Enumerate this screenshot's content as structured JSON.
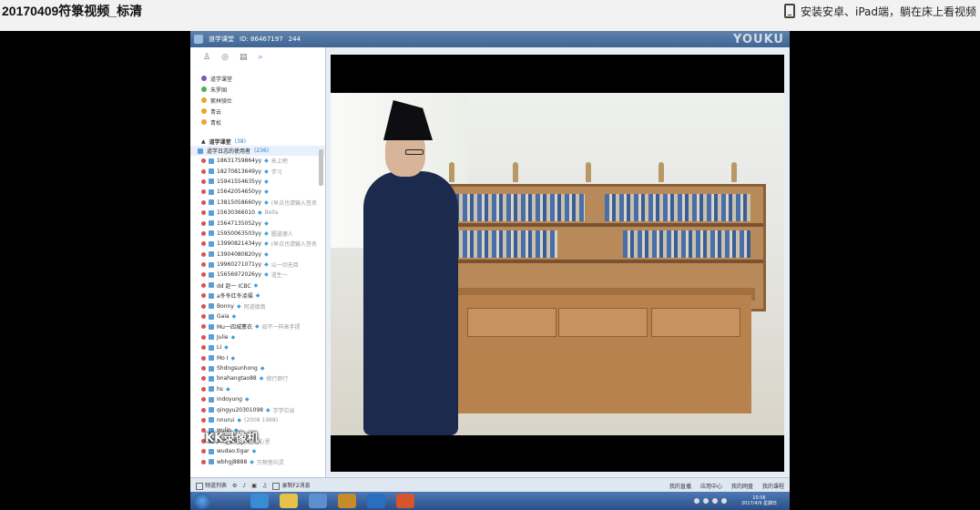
{
  "page": {
    "title": "20170409符箓视频_标清",
    "app_promo": "安装安卓、iPad端，躺在床上看视频"
  },
  "app": {
    "window_title": "道学课堂",
    "window_id": "ID: 86467197",
    "viewer_count": "244",
    "watermark": "YOUKU"
  },
  "sidebar": {
    "rooms": [
      {
        "label": "道学课堂",
        "color": "#7b58b8"
      },
      {
        "label": "朱罗国",
        "color": "#4caf50"
      },
      {
        "label": "紫林骑仕",
        "color": "#e7a62d"
      },
      {
        "label": "青云",
        "color": "#e7a62d"
      },
      {
        "label": "青松",
        "color": "#e7a62d"
      }
    ],
    "group": {
      "label": "道学课堂",
      "count": "(38)"
    },
    "subgroup": {
      "label": "道学日志的使用者",
      "count": "(236)"
    },
    "members": [
      {
        "name": "18631759864yy",
        "note": "来上吧"
      },
      {
        "name": "18270813649yy",
        "note": "学习"
      },
      {
        "name": "15941554635yy",
        "note": ""
      },
      {
        "name": "15642054650yy",
        "note": ""
      },
      {
        "name": "13815058660yy",
        "note": "(早点也请输入签名"
      },
      {
        "name": "15630366010",
        "note": "Bella"
      },
      {
        "name": "15647135052yy",
        "note": ""
      },
      {
        "name": "15950063503yy",
        "note": "圆道德人"
      },
      {
        "name": "13990821434yy",
        "note": "(早点也请输入签名"
      },
      {
        "name": "13904080820yy",
        "note": ""
      },
      {
        "name": "19960271071yy",
        "note": "以一切无目"
      },
      {
        "name": "15656972026yy",
        "note": "道生一"
      },
      {
        "name": "dd 赵一 ICBC",
        "note": ""
      },
      {
        "name": "a冬冬红冬凌福",
        "note": ""
      },
      {
        "name": "Bonny",
        "note": "阿道德真"
      },
      {
        "name": "Gaia",
        "note": ""
      },
      {
        "name": "Mu一四城薰衣",
        "note": "如不一样高手提"
      },
      {
        "name": "Julie",
        "note": ""
      },
      {
        "name": "LI",
        "note": ""
      },
      {
        "name": "Mo I",
        "note": ""
      },
      {
        "name": "Shdngsunhong",
        "note": ""
      },
      {
        "name": "bnahangtao88",
        "note": "修行即行"
      },
      {
        "name": "hs",
        "note": ""
      },
      {
        "name": "indoyung",
        "note": ""
      },
      {
        "name": "qingyu20301098",
        "note": "学学位出"
      },
      {
        "name": "nnurui",
        "note": "(2008 1988)"
      },
      {
        "name": "wulin",
        "note": ""
      },
      {
        "name": "pingqiong",
        "note": "当心里"
      },
      {
        "name": "wudao.tigar",
        "note": ""
      },
      {
        "name": "wbhgj8888",
        "note": "万物皆向灵"
      }
    ],
    "kk_watermark": "KK录像机"
  },
  "toolbar": {
    "left_label": "频道列表",
    "record_label": "录制F2消息",
    "right_items": [
      "我的直播",
      "应用中心",
      "我的网盘",
      "我的课程"
    ]
  },
  "taskbar": {
    "time": "10:56",
    "date": "2017/4/9 星期日"
  }
}
